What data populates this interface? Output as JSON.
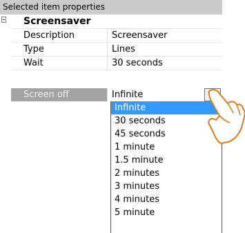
{
  "panel": {
    "title": "Selected item properties"
  },
  "category": {
    "label": "Screensaver"
  },
  "properties": [
    {
      "name": "Description",
      "value": "Screensaver"
    },
    {
      "name": "Type",
      "value": "Lines"
    },
    {
      "name": "Wait",
      "value": "30 seconds"
    },
    {
      "name": "Screen off",
      "value": "Infinite"
    }
  ],
  "dropdown": {
    "selected": "Infinite",
    "options": [
      "Infinite",
      "30 seconds",
      "45 seconds",
      "1 minute",
      "1.5 minute",
      "2 minutes",
      "3 minutes",
      "4 minutes",
      "5 minute"
    ]
  },
  "colors": {
    "highlight": "#3399ff",
    "title_bar": "#cbcbcb",
    "selected_name_bg": "#a3a3a3"
  },
  "icons": {
    "dropdown_toggle": "chevron-down-icon",
    "pointer": "pointing-hand-icon",
    "collapse": "collapse-icon"
  }
}
